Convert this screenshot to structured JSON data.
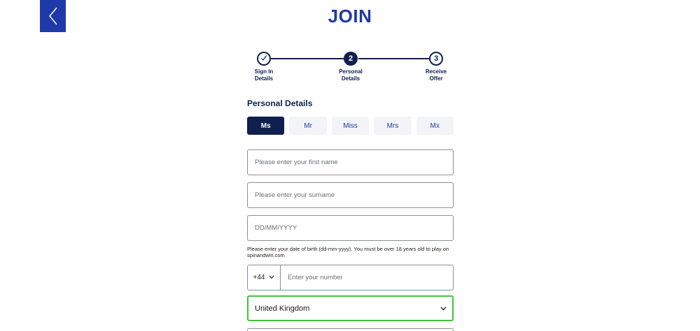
{
  "header": {
    "title": "JOIN",
    "back_icon": "chevron-left-icon"
  },
  "stepper": {
    "steps": [
      {
        "number": "",
        "label_line1": "Sign In",
        "label_line2": "Details",
        "state": "complete",
        "icon": "check-icon"
      },
      {
        "number": "2",
        "label_line1": "Personal",
        "label_line2": "Details",
        "state": "active"
      },
      {
        "number": "3",
        "label_line1": "Receive",
        "label_line2": "Offer",
        "state": "pending"
      }
    ]
  },
  "form": {
    "section_heading": "Personal Details",
    "titles": [
      {
        "label": "Ms",
        "selected": true
      },
      {
        "label": "Mr",
        "selected": false
      },
      {
        "label": "Miss",
        "selected": false
      },
      {
        "label": "Mrs",
        "selected": false
      },
      {
        "label": "Mx",
        "selected": false
      }
    ],
    "first_name_placeholder": "Please enter your first name",
    "surname_placeholder": "Please enter your surname",
    "dob_placeholder": "DD/MM/YYYY",
    "dob_hint": "Please enter your date of birth (dd-mm-yyyy). You must be over 18 years old to play on spinandwin.com",
    "phone": {
      "country_code": "+44",
      "placeholder": "Enter your number"
    },
    "country": {
      "selected": "United Kingdom"
    }
  },
  "colors": {
    "brand_blue": "#1e3aa8",
    "navy": "#0f1f4f",
    "valid_green": "#3cc43c"
  }
}
